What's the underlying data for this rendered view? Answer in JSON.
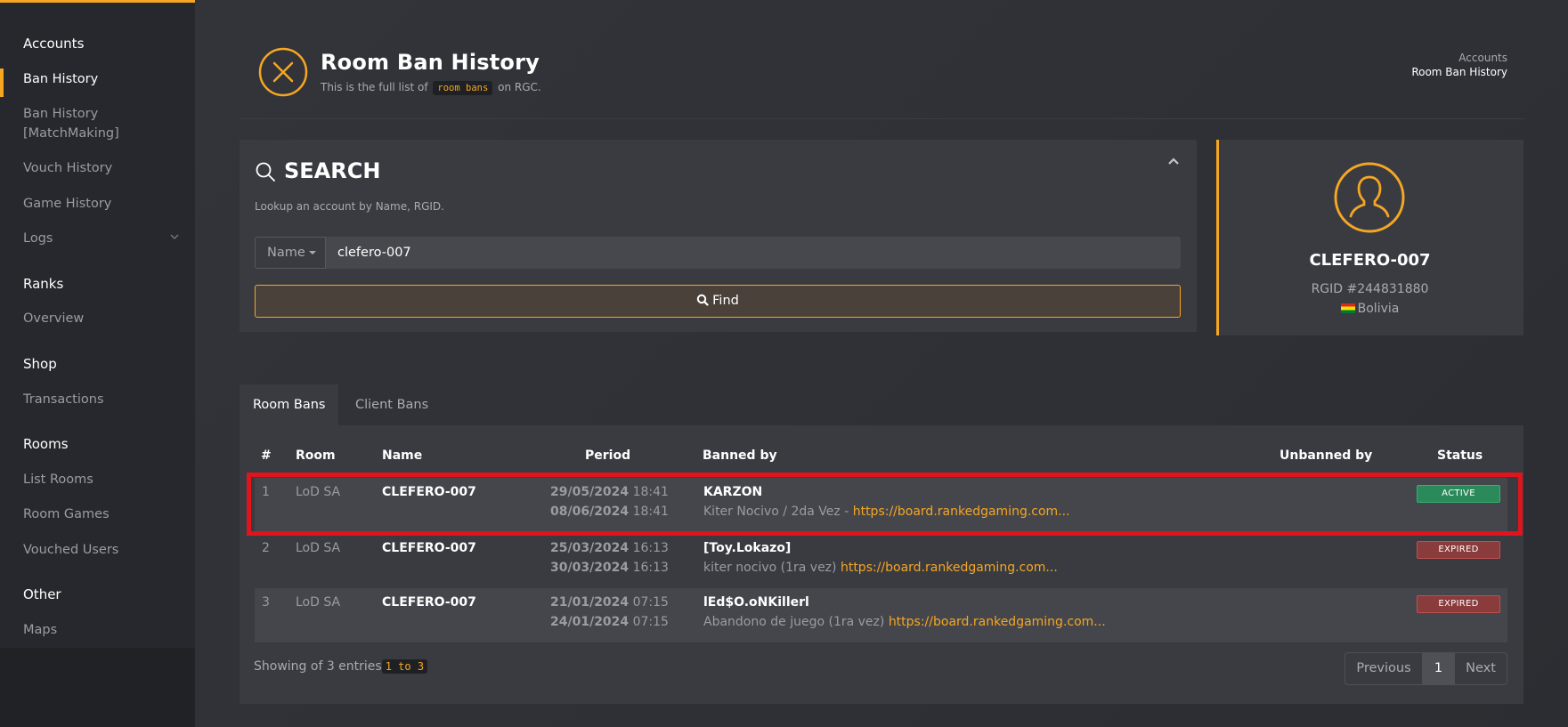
{
  "sidebar": {
    "sections": [
      {
        "label": "Accounts"
      },
      {
        "label": "Ranks"
      },
      {
        "label": "Shop"
      },
      {
        "label": "Rooms"
      },
      {
        "label": "Other"
      }
    ],
    "items": {
      "ban_history": "Ban History",
      "ban_history_mm_1": "Ban History",
      "ban_history_mm_2": "[MatchMaking]",
      "vouch_history": "Vouch History",
      "game_history": "Game History",
      "logs": "Logs",
      "overview": "Overview",
      "transactions": "Transactions",
      "list_rooms": "List Rooms",
      "room_games": "Room Games",
      "vouched_users": "Vouched Users",
      "maps": "Maps"
    }
  },
  "header": {
    "title": "Room Ban History",
    "subtitle_pre": "This is the full list of",
    "subtitle_code": "room bans",
    "subtitle_post": "on RGC.",
    "breadcrumb": [
      "Accounts",
      "Room Ban History"
    ]
  },
  "search": {
    "title": "SEARCH",
    "hint": "Lookup an account by Name, RGID.",
    "field_type": "Name",
    "value": "clefero-007",
    "find_label": "Find"
  },
  "profile": {
    "name": "CLEFERO-007",
    "rgid": "RGID #244831880",
    "country": "Bolivia"
  },
  "tabs": [
    "Room Bans",
    "Client Bans"
  ],
  "table": {
    "headers": [
      "#",
      "Room",
      "Name",
      "Period",
      "Banned by",
      "Unbanned by",
      "Status"
    ],
    "rows": [
      {
        "num": "1",
        "room": "LoD SA",
        "name": "CLEFERO-007",
        "start_date": "29/05/2024",
        "start_time": "18:41",
        "end_date": "08/06/2024",
        "end_time": "18:41",
        "banned_by": "KARZON",
        "reason": "Kiter Nocivo / 2da Vez - ",
        "link": "https://board.rankedgaming.com...",
        "status": "ACTIVE"
      },
      {
        "num": "2",
        "room": "LoD SA",
        "name": "CLEFERO-007",
        "start_date": "25/03/2024",
        "start_time": "16:13",
        "end_date": "30/03/2024",
        "end_time": "16:13",
        "banned_by": "[Toy.Lokazo]",
        "reason": "kiter nocivo (1ra vez) ",
        "link": "https://board.rankedgaming.com...",
        "status": "EXPIRED"
      },
      {
        "num": "3",
        "room": "LoD SA",
        "name": "CLEFERO-007",
        "start_date": "21/01/2024",
        "start_time": "07:15",
        "end_date": "24/01/2024",
        "end_time": "07:15",
        "banned_by": "lEd$O.oNKillerl",
        "reason": "Abandono de juego (1ra vez) ",
        "link": "https://board.rankedgaming.com...",
        "status": "EXPIRED"
      }
    ],
    "showing_pre": "Showing of 3 entries",
    "showing_code": "1 to 3",
    "pager": {
      "previous": "Previous",
      "current": "1",
      "next": "Next"
    }
  },
  "colors": {
    "accent": "#f5a623",
    "active_badge": "#2a8a5a",
    "expired_badge": "#8a3b3b",
    "highlight": "#e0141c"
  }
}
